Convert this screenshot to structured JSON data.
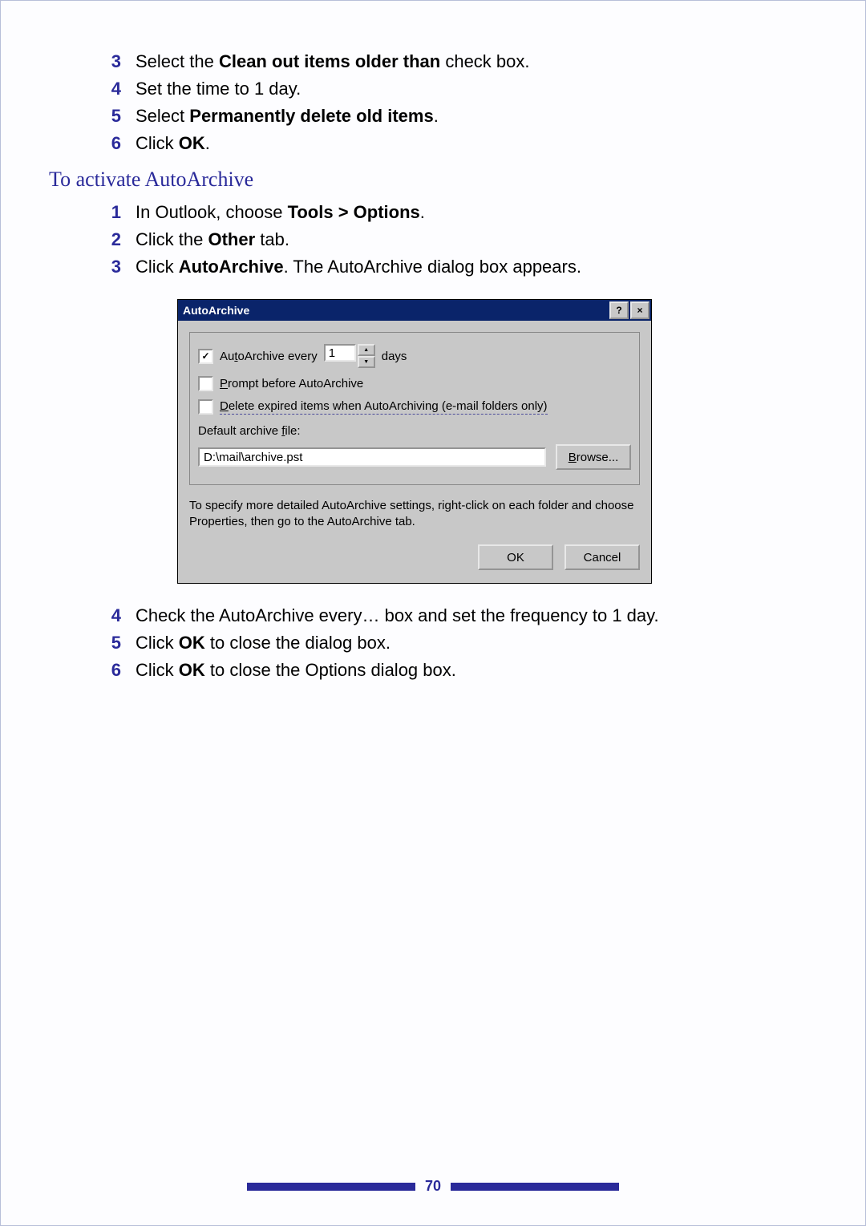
{
  "steps_top": [
    {
      "n": "3",
      "html": "Select the <b>Clean out items older than</b> check box."
    },
    {
      "n": "4",
      "html": "Set the time to 1 day."
    },
    {
      "n": "5",
      "html": "Select <b>Permanently delete old items</b>."
    },
    {
      "n": "6",
      "html": "Click <b>OK</b>."
    }
  ],
  "section_title": "To activate AutoArchive",
  "steps_mid": [
    {
      "n": "1",
      "html": "In Outlook, choose <b>Tools &gt; Options</b>."
    },
    {
      "n": "2",
      "html": "Click the <b>Other</b> tab."
    },
    {
      "n": "3",
      "html": "Click <b>AutoArchive</b>. The AutoArchive dialog box appears."
    }
  ],
  "dialog": {
    "title": "AutoArchive",
    "help_glyph": "?",
    "close_glyph": "×",
    "row1_prefix": "Au",
    "row1_ul": "t",
    "row1_suffix": "oArchive every",
    "row1_value": "1",
    "row1_days": "days",
    "row2_ul": "P",
    "row2_txt": "rompt before AutoArchive",
    "row3_ul": "D",
    "row3_txt": "elete expired items when AutoArchiving (e-mail folders only)",
    "file_label_pre": "Default archive ",
    "file_label_ul": "f",
    "file_label_post": "ile:",
    "file_value": "D:\\mail\\archive.pst",
    "browse_ul": "B",
    "browse_rest": "rowse...",
    "hint": "To specify more detailed AutoArchive settings, right-click on each folder and choose Properties, then go to the AutoArchive tab.",
    "ok": "OK",
    "cancel": "Cancel"
  },
  "steps_bottom": [
    {
      "n": "4",
      "html": "Check the AutoArchive every… box and set the frequency to 1 day."
    },
    {
      "n": "5",
      "html": "Click <b>OK</b> to close the dialog box."
    },
    {
      "n": "6",
      "html": "Click <b>OK</b> to close the Options dialog box."
    }
  ],
  "page_number": "70"
}
